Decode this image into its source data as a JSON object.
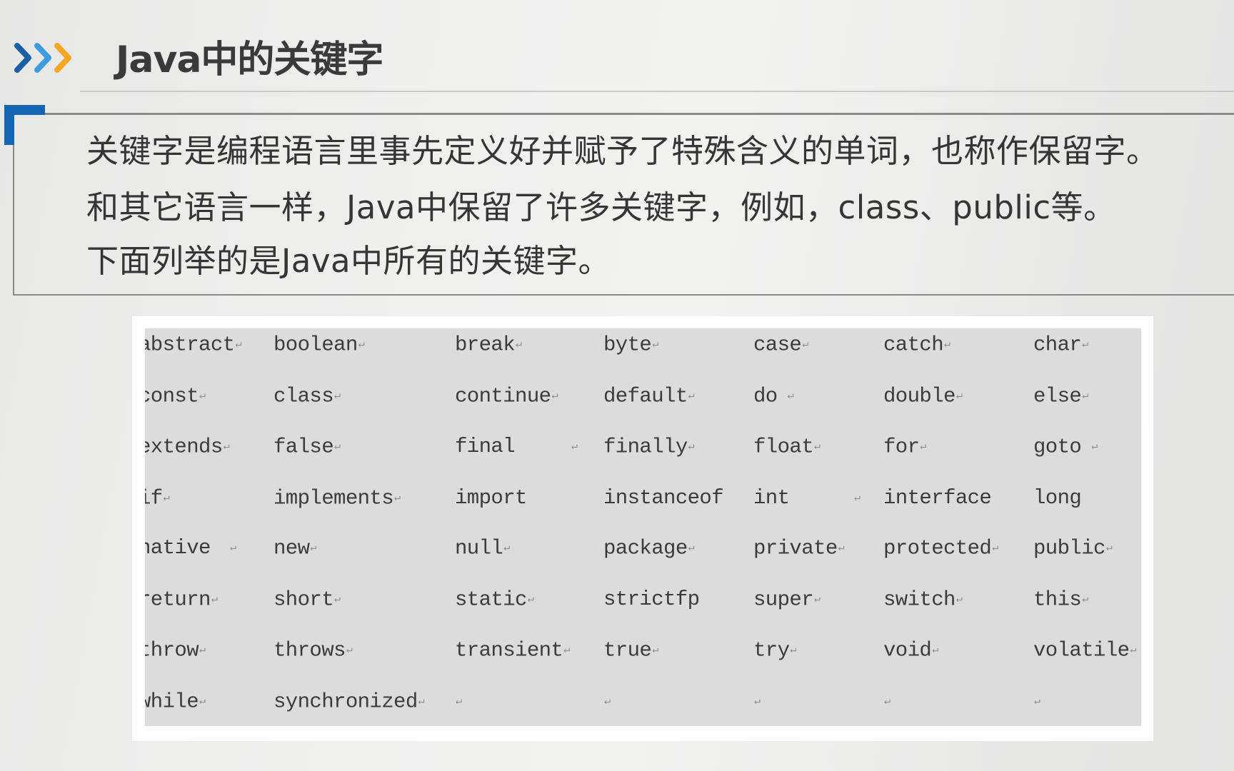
{
  "header": {
    "title": "Java中的关键字",
    "icon": "triple-chevron-right-icon",
    "icon_colors": [
      "#1a5fa8",
      "#3d9be0",
      "#f5a623"
    ]
  },
  "intro": {
    "accent_color": "#1565b5",
    "lines": [
      "关键字是编程语言里事先定义好并赋予了特殊含义的单词，也称作保留字。",
      "和其它语言一样，Java中保留了许多关键字，例如，class、public等。",
      "下面列举的是Java中所有的关键字。"
    ]
  },
  "keywords": {
    "paragraph_mark": "↵",
    "rows": [
      [
        {
          "t": "abstract",
          "m": "tight"
        },
        {
          "t": "boolean",
          "m": "tight"
        },
        {
          "t": "break",
          "m": "tight"
        },
        {
          "t": "byte",
          "m": "tight"
        },
        {
          "t": "case",
          "m": "tight"
        },
        {
          "t": "catch",
          "m": "tight"
        },
        {
          "t": "char",
          "m": "tight"
        }
      ],
      [
        {
          "t": "const",
          "m": "tight"
        },
        {
          "t": "class",
          "m": "tight"
        },
        {
          "t": "continue",
          "m": "tight"
        },
        {
          "t": "default",
          "m": "tight"
        },
        {
          "t": "do",
          "m": "spaced"
        },
        {
          "t": "double",
          "m": "tight"
        },
        {
          "t": "else",
          "m": "tight"
        }
      ],
      [
        {
          "t": "extends",
          "m": "tight"
        },
        {
          "t": "false",
          "m": "tight"
        },
        {
          "t": "final",
          "m": "far"
        },
        {
          "t": "finally",
          "m": "tight"
        },
        {
          "t": "float",
          "m": "tight"
        },
        {
          "t": "for",
          "m": "tight"
        },
        {
          "t": "goto",
          "m": "spaced"
        }
      ],
      [
        {
          "t": "if",
          "m": "tight"
        },
        {
          "t": "implements",
          "m": "tight"
        },
        {
          "t": "import",
          "m": ""
        },
        {
          "t": "instanceof",
          "m": ""
        },
        {
          "t": "int",
          "m": "far"
        },
        {
          "t": "interface",
          "m": ""
        },
        {
          "t": "long",
          "m": ""
        }
      ],
      [
        {
          "t": "native",
          "m": "far"
        },
        {
          "t": "new",
          "m": "tight"
        },
        {
          "t": "null",
          "m": "tight"
        },
        {
          "t": "package",
          "m": "tight"
        },
        {
          "t": "private",
          "m": "tight"
        },
        {
          "t": "protected",
          "m": "tight"
        },
        {
          "t": "public",
          "m": "tight"
        }
      ],
      [
        {
          "t": "return",
          "m": "tight"
        },
        {
          "t": "short",
          "m": "tight"
        },
        {
          "t": "static",
          "m": "tight"
        },
        {
          "t": "strictfp",
          "m": ""
        },
        {
          "t": "super",
          "m": "tight"
        },
        {
          "t": "switch",
          "m": "tight"
        },
        {
          "t": "this",
          "m": "tight"
        }
      ],
      [
        {
          "t": "throw",
          "m": "tight"
        },
        {
          "t": "throws",
          "m": "tight"
        },
        {
          "t": "transient",
          "m": "tight"
        },
        {
          "t": "true",
          "m": "tight"
        },
        {
          "t": "try",
          "m": "tight"
        },
        {
          "t": "void",
          "m": "tight"
        },
        {
          "t": "volatile",
          "m": "tight"
        }
      ],
      [
        {
          "t": "while",
          "m": "tight"
        },
        {
          "t": "synchronized",
          "m": "tight"
        },
        {
          "t": "",
          "m": "tight"
        },
        {
          "t": "",
          "m": "tight"
        },
        {
          "t": "",
          "m": "tight"
        },
        {
          "t": "",
          "m": "tight"
        },
        {
          "t": "",
          "m": "tight"
        }
      ]
    ]
  }
}
